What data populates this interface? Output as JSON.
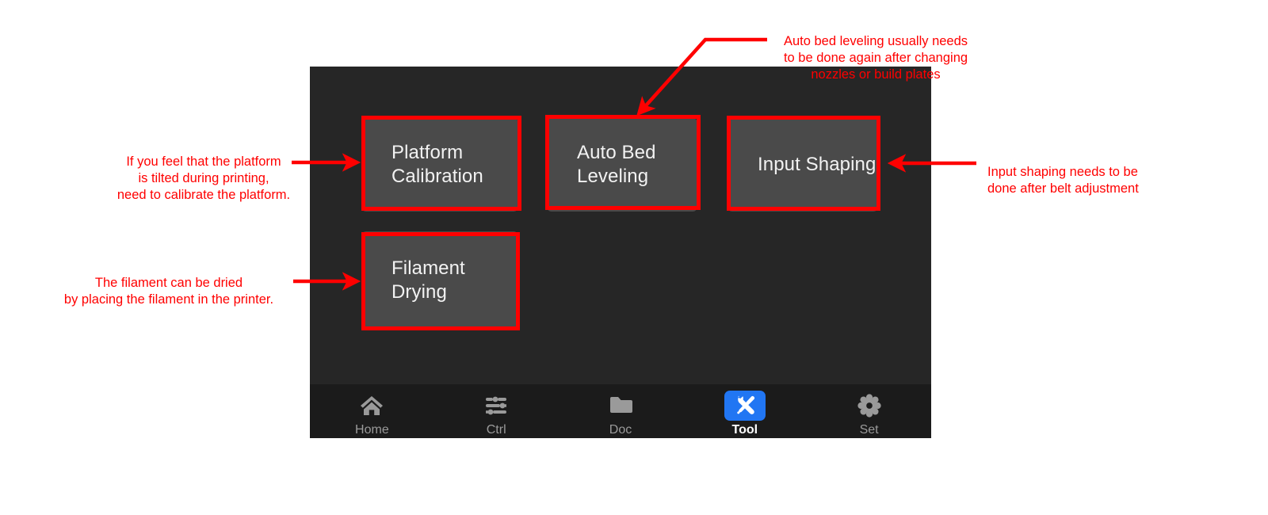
{
  "device_screen": {
    "background_color": "#262626",
    "tiles": [
      {
        "id": "platform-calibration",
        "label": "Platform\nCalibration"
      },
      {
        "id": "auto-bed-leveling",
        "label": "Auto Bed\nLeveling"
      },
      {
        "id": "input-shaping",
        "label": "Input Shaping"
      },
      {
        "id": "filament-drying",
        "label": "Filament Drying"
      }
    ],
    "bottom_nav": {
      "active_color": "#2176f3",
      "items": [
        {
          "id": "home",
          "label": "Home",
          "icon": "home-icon",
          "active": false
        },
        {
          "id": "ctrl",
          "label": "Ctrl",
          "icon": "sliders-icon",
          "active": false
        },
        {
          "id": "doc",
          "label": "Doc",
          "icon": "folder-icon",
          "active": false
        },
        {
          "id": "tool",
          "label": "Tool",
          "icon": "tools-icon",
          "active": true
        },
        {
          "id": "set",
          "label": "Set",
          "icon": "gear-icon",
          "active": false
        }
      ]
    }
  },
  "annotations": {
    "color": "#ff0000",
    "callouts": [
      {
        "id": "platform-calibration-note",
        "text": "If you feel that the platform\nis tilted during printing,\nneed to calibrate the platform.",
        "target": "platform-calibration"
      },
      {
        "id": "auto-bed-leveling-note",
        "text": "Auto bed leveling usually needs\nto be done again after changing\nnozzles or build plates",
        "target": "auto-bed-leveling"
      },
      {
        "id": "input-shaping-note",
        "text": "Input shaping needs to be\ndone after belt adjustment",
        "target": "input-shaping"
      },
      {
        "id": "filament-drying-note",
        "text": "The filament can be dried\nby placing the filament in the printer.",
        "target": "filament-drying"
      }
    ]
  }
}
